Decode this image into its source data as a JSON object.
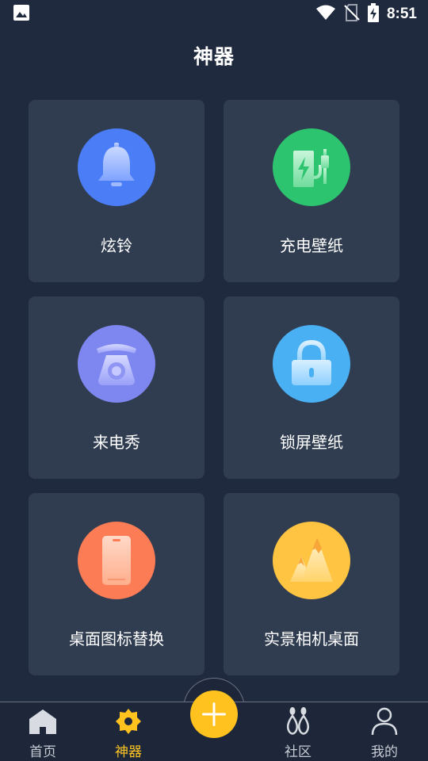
{
  "status_bar": {
    "time": "8:51",
    "icons": [
      "image-icon",
      "wifi-icon",
      "no-sim-icon",
      "battery-charging-icon"
    ]
  },
  "page": {
    "title": "神器"
  },
  "cards": [
    {
      "label": "炫铃",
      "icon": "bell-icon",
      "color": "#4a7df6"
    },
    {
      "label": "充电壁纸",
      "icon": "charging-icon",
      "color": "#2cc46e"
    },
    {
      "label": "来电秀",
      "icon": "telephone-icon",
      "color": "#7e86f0"
    },
    {
      "label": "锁屏壁纸",
      "icon": "lock-icon",
      "color": "#4ab0f4"
    },
    {
      "label": "桌面图标替换",
      "icon": "phone-icon",
      "color": "#fb7c55"
    },
    {
      "label": "实景相机桌面",
      "icon": "mountain-icon",
      "color": "#ffc442"
    }
  ],
  "bottom_nav": {
    "items": [
      {
        "label": "首页",
        "icon": "home-icon",
        "active": false
      },
      {
        "label": "神器",
        "icon": "gear-icon",
        "active": true
      },
      {
        "label": "社区",
        "icon": "community-icon",
        "active": false
      },
      {
        "label": "我的",
        "icon": "user-icon",
        "active": false
      }
    ],
    "fab_icon": "plus-icon"
  },
  "colors": {
    "background": "#1f2a3e",
    "card": "#303d50",
    "accent": "#ffc21f"
  }
}
